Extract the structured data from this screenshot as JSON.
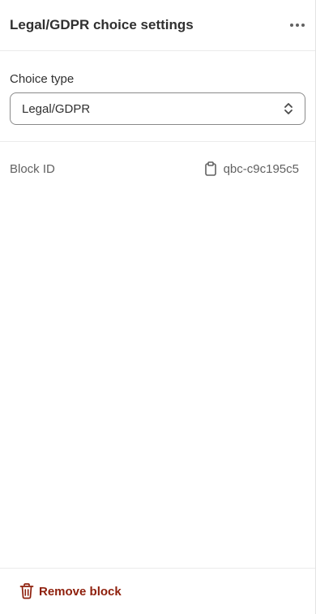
{
  "header": {
    "title": "Legal/GDPR choice settings",
    "more_icon": "more-horizontal-icon"
  },
  "choice_type": {
    "label": "Choice type",
    "selected": "Legal/GDPR",
    "icon": "select-chevrons-icon"
  },
  "block_id": {
    "label": "Block ID",
    "value": "qbc-c9c195c5",
    "icon": "clipboard-icon"
  },
  "footer": {
    "remove_label": "Remove block",
    "remove_icon": "trash-icon",
    "remove_color": "#8e1f0b"
  }
}
